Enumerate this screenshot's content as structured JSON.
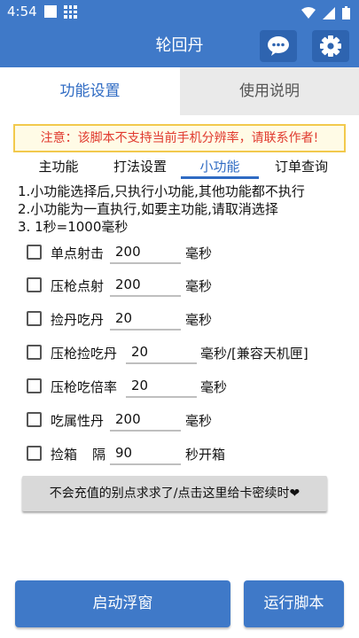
{
  "status": {
    "time": "4:54"
  },
  "app": {
    "title": "轮回丹"
  },
  "tabs": [
    {
      "label": "功能设置",
      "active": true
    },
    {
      "label": "使用说明",
      "active": false
    }
  ],
  "notice": "注意：该脚本不支持当前手机分辨率，请联系作者!",
  "sub_tabs": [
    {
      "label": "主功能"
    },
    {
      "label": "打法设置"
    },
    {
      "label": "小功能",
      "active": true
    },
    {
      "label": "订单查询"
    }
  ],
  "info": [
    "1.小功能选择后,只执行小功能,其他功能都不执行",
    "2.小功能为一直执行,如要主功能,请取消选择",
    "3. 1秒=1000毫秒"
  ],
  "options": [
    {
      "label": "单点射击",
      "value": "200",
      "unit": "毫秒",
      "checked": false
    },
    {
      "label": "压枪点射",
      "value": "200",
      "unit": "毫秒",
      "checked": false
    },
    {
      "label": "捡丹吃丹",
      "value": "20",
      "unit": "毫秒",
      "checked": false
    },
    {
      "label": "压枪捡吃丹",
      "value": "20",
      "unit": "毫秒/[兼容天机匣]",
      "checked": false
    },
    {
      "label": "压枪吃倍率",
      "value": "20",
      "unit": "毫秒",
      "checked": false
    },
    {
      "label": "吃属性丹",
      "value": "200",
      "unit": "毫秒",
      "checked": false
    },
    {
      "label": "捡箱",
      "label2": "隔",
      "value": "90",
      "unit": "秒开箱",
      "checked": false
    }
  ],
  "card_button": "不会充值的别点求求了/点击这里给卡密续时❤",
  "buttons": {
    "float": "启动浮窗",
    "run": "运行脚本"
  },
  "colors": {
    "primary": "#3f79c8",
    "accent_text": "#2f6bc3",
    "notice_text": "#e03a2e",
    "notice_border": "#f2c94c"
  }
}
